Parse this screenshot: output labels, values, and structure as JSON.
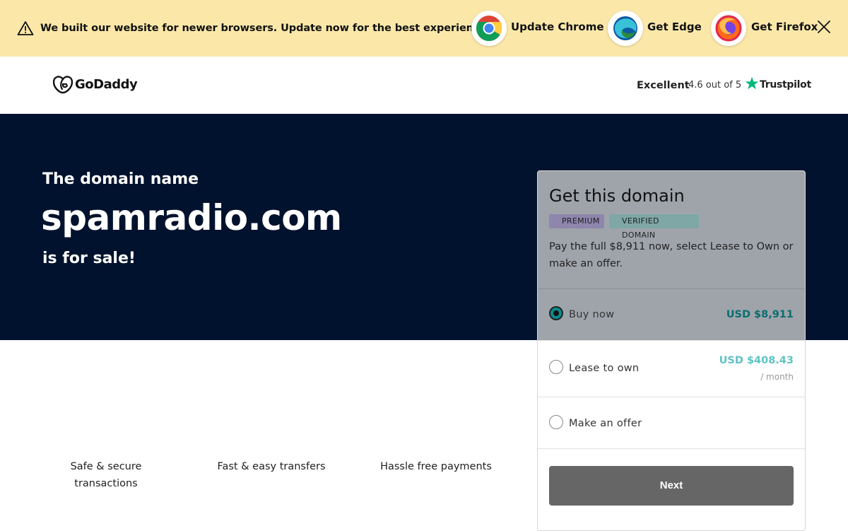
{
  "banner": {
    "message": "We built our website for newer browsers. Update now for the best experience.",
    "chrome_label": "Update Chrome",
    "edge_label": "Get Edge",
    "firefox_label": "Get Firefox"
  },
  "header": {
    "logo_text": "GoDaddy",
    "trustpilot": {
      "excellent": "Excellent",
      "rating": "4.6 out of 5",
      "brand": "Trustpilot",
      "star_color": "#00b67a"
    }
  },
  "hero": {
    "line1": "The domain name",
    "domain": "spamradio.com",
    "line3": "is for sale!",
    "bg_color": "#00122d"
  },
  "features": [
    "Safe & secure transactions",
    "Fast & easy transfers",
    "Hassle free payments"
  ],
  "card": {
    "title": "Get this domain",
    "badges": [
      "PREMIUM",
      "VERIFIED DOMAIN"
    ],
    "description": "Pay the full $8,911 now, select Lease to Own or make an offer.",
    "options": [
      {
        "label": "Buy now",
        "price": "USD $8,911",
        "selected": true
      },
      {
        "label": "Lease to own",
        "price": "USD $408.43",
        "period": "/ month",
        "selected": false
      },
      {
        "label": "Make an offer",
        "selected": false
      }
    ],
    "next_label": "Next"
  },
  "colors": {
    "banner_bg": "#fbe8a9",
    "accent_teal": "#0a6e70",
    "button_gray": "#666666"
  }
}
